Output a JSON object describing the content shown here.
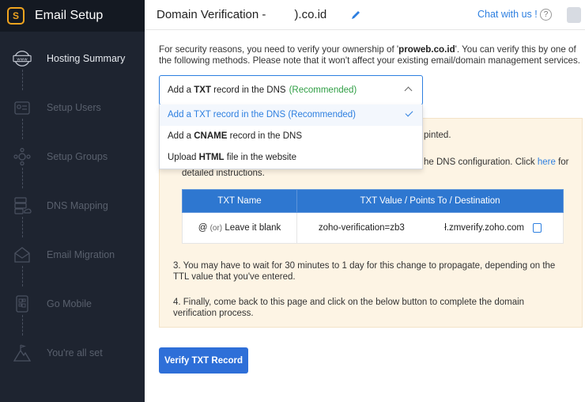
{
  "app": {
    "title": "Email Setup",
    "logo_glyph": "S",
    "accent": "#f0a41f"
  },
  "sidebar": {
    "steps": [
      {
        "label": "Hosting Summary",
        "icon": "www-globe-icon",
        "active": true
      },
      {
        "label": "Setup Users",
        "icon": "user-card-icon"
      },
      {
        "label": "Setup Groups",
        "icon": "group-network-icon"
      },
      {
        "label": "DNS Mapping",
        "icon": "server-cloud-icon"
      },
      {
        "label": "Email Migration",
        "icon": "envelope-icon"
      },
      {
        "label": "Go Mobile",
        "icon": "mobile-qr-icon"
      },
      {
        "label": "You're all set",
        "icon": "mountain-flag-icon"
      }
    ]
  },
  "header": {
    "title": "Domain Verification -",
    "domain_suffix": ").co.id",
    "chat_link": "Chat with us !",
    "help_glyph": "?"
  },
  "intro": {
    "before": "For security reasons, you need to verify your ownership of '",
    "domain": "proweb.co.id",
    "after": "'. You can verify this by one of the following methods. Please note that it won't affect your existing email/domain management services."
  },
  "method_select": {
    "value_prefix": "Add a ",
    "value_bold": "TXT",
    "value_rest": " record in the DNS",
    "recommended": "(Recommended)",
    "options": [
      {
        "label": "Add a TXT record in the DNS (Recommended)",
        "selected": true
      },
      {
        "prefix": "Add a ",
        "bold": "CNAME",
        "rest": " record in the DNS"
      },
      {
        "prefix": "Upload ",
        "bold": "HTML",
        "rest": " file in the website"
      }
    ]
  },
  "instructions": {
    "step1_fragment": "pinted.",
    "step2_fragment": "he DNS configuration. Click",
    "step2_link": "here",
    "step2_after": "for",
    "step2_line2": "detailed instructions.",
    "step3": "3. You may have to wait for 30 minutes to 1 day for this change to propagate, depending on the TTL value that you've entered.",
    "step4": "4. Finally, come back to this page and click on the below button to complete the domain verification process."
  },
  "dns_table": {
    "headers": [
      "TXT Name",
      "TXT Value / Points To / Destination"
    ],
    "name_at": "@",
    "name_or": "(or)",
    "name_blank": "Leave it blank",
    "value_part1": "zoho-verification=zb3",
    "value_part2": "ł.zmverify.zoho.com"
  },
  "verify_button": "Verify TXT Record"
}
